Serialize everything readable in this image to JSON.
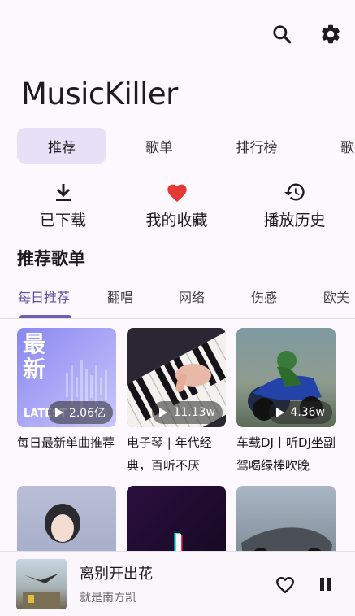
{
  "app": {
    "title": "MusicKiller"
  },
  "icons": {
    "search": "search-icon",
    "settings": "gear-icon"
  },
  "tabs": [
    {
      "label": "推荐",
      "active": true
    },
    {
      "label": "歌单",
      "active": false
    },
    {
      "label": "排行榜",
      "active": false
    },
    {
      "label": "歌手",
      "active": false
    }
  ],
  "quick_actions": [
    {
      "label": "已下载",
      "icon": "download-icon"
    },
    {
      "label": "我的收藏",
      "icon": "heart-icon",
      "color": "#e53935"
    },
    {
      "label": "播放历史",
      "icon": "history-icon"
    }
  ],
  "section": {
    "title": "推荐歌单"
  },
  "subtabs": [
    {
      "label": "每日推荐",
      "active": true
    },
    {
      "label": "翻唱",
      "active": false
    },
    {
      "label": "网络",
      "active": false
    },
    {
      "label": "伤感",
      "active": false
    },
    {
      "label": "欧美",
      "active": false
    }
  ],
  "playlists": [
    {
      "title": "每日最新单曲推荐",
      "plays": "2.06亿",
      "cover_text": "最新",
      "cover_sub": "LATEST"
    },
    {
      "title": "电子琴 | 年代经典，百听不厌",
      "plays": "11.13w"
    },
    {
      "title": "车载DJ丨听DJ坐副驾喝绿棒吹晚",
      "plays": "4.36w"
    },
    {
      "title": "",
      "plays": ""
    },
    {
      "title": "",
      "plays": ""
    },
    {
      "title": "",
      "plays": ""
    }
  ],
  "player": {
    "title": "离别开出花",
    "artist": "就是南方凯"
  },
  "colors": {
    "accent": "#6a5fb0",
    "tab_active_bg": "#e7e0f6",
    "heart": "#e53935",
    "background": "#fdf8fd"
  }
}
